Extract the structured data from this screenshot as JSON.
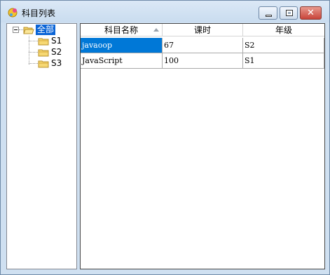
{
  "window": {
    "title": "科目列表",
    "icon": "app-icon",
    "controls": [
      "minimize-icon",
      "maximize-icon",
      "close-icon"
    ]
  },
  "tree": {
    "root": {
      "label": "全部",
      "selected": true,
      "expanded": true
    },
    "children": [
      {
        "label": "S1"
      },
      {
        "label": "S2"
      },
      {
        "label": "S3"
      }
    ]
  },
  "grid": {
    "columns": [
      "科目名称",
      "课时",
      "年级"
    ],
    "sorted_column": "科目名称",
    "rows": [
      {
        "cells": [
          "javaoop",
          "67",
          "S2"
        ],
        "selected": true
      },
      {
        "cells": [
          "JavaScript",
          "100",
          "S1"
        ],
        "selected": false
      }
    ]
  },
  "colors": {
    "selection": "#0078d7",
    "title_bar": "#c9dcef",
    "close_button": "#c8443a"
  }
}
